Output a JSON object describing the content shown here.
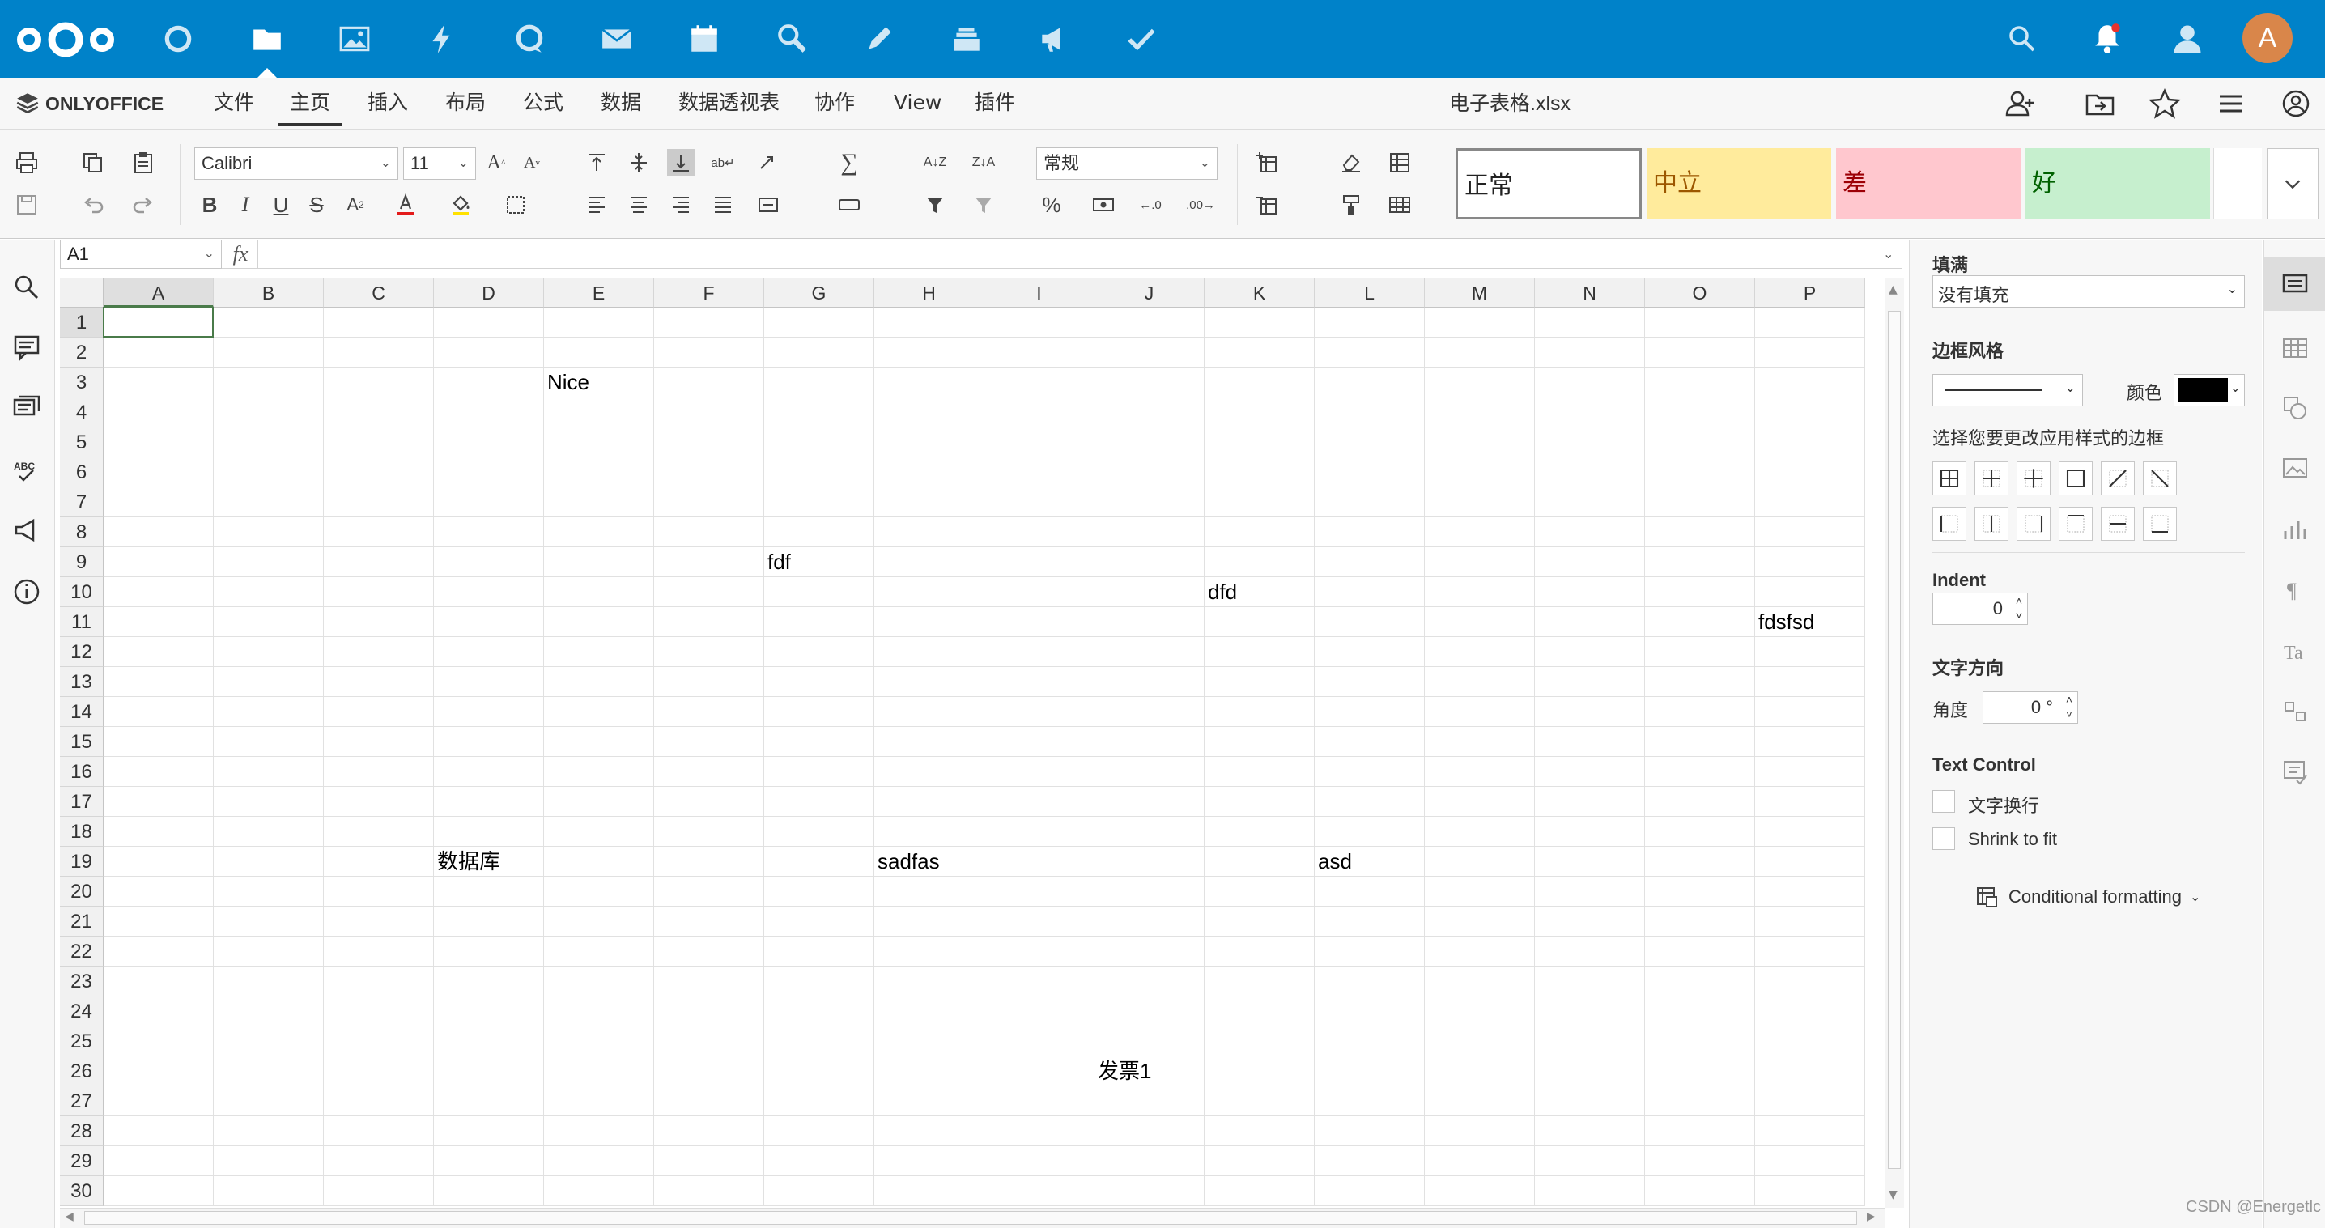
{
  "nextcloud": {
    "apps": [
      "dashboard",
      "files",
      "photos",
      "activity",
      "talk",
      "mail",
      "calendar",
      "search-app",
      "notes",
      "deck",
      "announcements",
      "tasks"
    ],
    "avatar_letter": "A",
    "accent": "#0082c9"
  },
  "onlyoffice": {
    "logo": "ONLYOFFICE",
    "tabs": [
      "文件",
      "主页",
      "插入",
      "布局",
      "公式",
      "数据",
      "数据透视表",
      "协作",
      "View",
      "插件"
    ],
    "active_tab": "主页",
    "doc_title": "电子表格.xlsx"
  },
  "toolbar": {
    "font_name": "Calibri",
    "font_size": "11",
    "number_format": "常规",
    "styles": [
      {
        "label": "正常",
        "bg": "#ffffff",
        "color": "#000000"
      },
      {
        "label": "中立",
        "bg": "#ffeb9c",
        "color": "#9c5700"
      },
      {
        "label": "差",
        "bg": "#ffc7ce",
        "color": "#9c0006"
      },
      {
        "label": "好",
        "bg": "#c6efce",
        "color": "#006100"
      }
    ],
    "bold": "B",
    "italic": "I",
    "underline": "U",
    "strike": "S",
    "percent": "%"
  },
  "formula_bar": {
    "name_box": "A1",
    "fx": "fx",
    "value": ""
  },
  "sheet": {
    "columns": [
      "A",
      "B",
      "C",
      "D",
      "E",
      "F",
      "G",
      "H",
      "I",
      "J",
      "K",
      "L",
      "M",
      "N",
      "O",
      "P"
    ],
    "rows": [
      "1",
      "2",
      "3",
      "4",
      "5",
      "6",
      "7",
      "8",
      "9",
      "10",
      "11",
      "12",
      "13",
      "14",
      "15",
      "16",
      "17",
      "18",
      "19",
      "20",
      "21",
      "22",
      "23",
      "24",
      "25",
      "26",
      "27",
      "28",
      "29",
      "30"
    ],
    "cells": [
      {
        "ref": "E3",
        "value": "Nice"
      },
      {
        "ref": "G9",
        "value": "fdf"
      },
      {
        "ref": "K10",
        "value": "dfd"
      },
      {
        "ref": "P11",
        "value": "fdsfsd"
      },
      {
        "ref": "D19",
        "value": "数据库"
      },
      {
        "ref": "H19",
        "value": "sadfas"
      },
      {
        "ref": "L19",
        "value": "asd"
      },
      {
        "ref": "J26",
        "value": "发票1"
      }
    ],
    "selected": "A1"
  },
  "right_panel": {
    "fill_title": "填满",
    "fill_value": "没有填充",
    "border_title": "边框风格",
    "color_label": "颜色",
    "border_color": "#000000",
    "border_hint": "选择您要更改应用样式的边框",
    "indent_title": "Indent",
    "indent_value": "0",
    "direction_title": "文字方向",
    "angle_label": "角度",
    "angle_value": "0 °",
    "text_control_title": "Text Control",
    "wrap_label": "文字换行",
    "shrink_label": "Shrink to fit",
    "cond_format_label": "Conditional formatting"
  },
  "watermark": "CSDN @Energetlc"
}
